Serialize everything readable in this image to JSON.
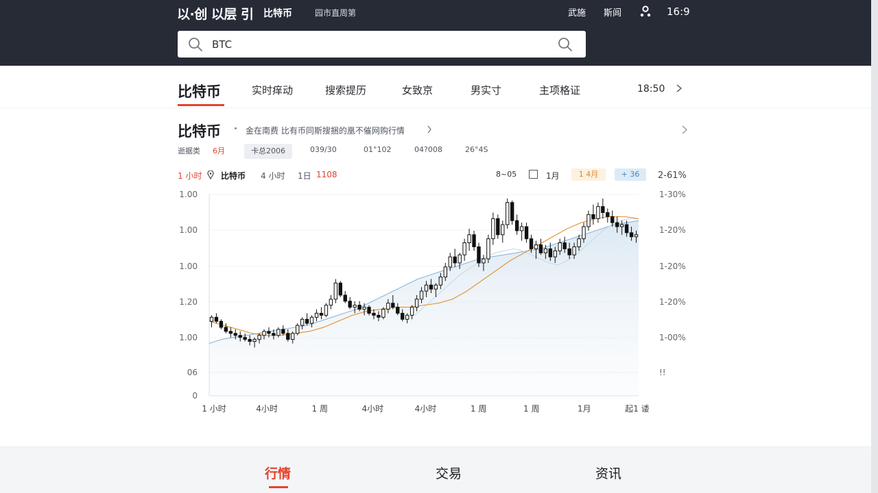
{
  "header": {
    "logo": "以·创 以层 引",
    "nav_primary": "比特币",
    "nav_secondary": "园市直周第",
    "right_links": [
      "武施",
      "斯闾"
    ],
    "clock": "16:9"
  },
  "search": {
    "value": "BTC",
    "placeholder": "BTC"
  },
  "tabs": {
    "active": "比特币",
    "items": [
      "实时痒动",
      "搜索提历",
      "女致京",
      "男实寸",
      "主项格证"
    ],
    "time": "18:50"
  },
  "section": {
    "title": "比特币",
    "desc": "金在南费 比有币同斯搜捆的凰不催网购行情",
    "filter_label": "逝据类",
    "filter_value": "6月",
    "chip": "卡总2006",
    "periods": [
      "039/30",
      "01°102",
      "04?008",
      "26°4S"
    ]
  },
  "chart_header": {
    "interval_active": "1 小时",
    "asset": "比特币",
    "interval_4h": "4 小时",
    "interval_1d": "1日",
    "interval_1d_value": "1108",
    "range_label": "8~05",
    "month_1": "1月",
    "pill_4m": "1 4月",
    "pill_36": "+ 36",
    "right_pct": "2-61%"
  },
  "chart_data": {
    "type": "line",
    "title": "",
    "xlabel": "",
    "ylabel": "",
    "x_ticks": [
      "1 小时",
      "4小时",
      "1 周",
      "4小时",
      "4小时",
      "1 周",
      "1 周",
      "1月",
      "起1 诿"
    ],
    "y_ticks_left": [
      "1.00",
      "1.00",
      "1.00",
      "1.20",
      "1.00",
      "06",
      "0"
    ],
    "y_ticks_right": [
      "1-30%",
      "1-20%",
      "1-20%",
      "1-20%",
      "1-00%",
      "!!"
    ],
    "ylim": [
      0,
      100
    ],
    "grid": true,
    "candles": [
      [
        37,
        40,
        34,
        39
      ],
      [
        39,
        41,
        36,
        37
      ],
      [
        37,
        38,
        33,
        34
      ],
      [
        34,
        36,
        31,
        32
      ],
      [
        32,
        34,
        29,
        31
      ],
      [
        31,
        33,
        28,
        30
      ],
      [
        30,
        32,
        27,
        29
      ],
      [
        29,
        31,
        27,
        28
      ],
      [
        28,
        30,
        25,
        27
      ],
      [
        27,
        29,
        24,
        28
      ],
      [
        28,
        31,
        26,
        30
      ],
      [
        30,
        33,
        28,
        32
      ],
      [
        32,
        34,
        29,
        31
      ],
      [
        31,
        33,
        28,
        30
      ],
      [
        30,
        34,
        29,
        33
      ],
      [
        33,
        35,
        30,
        31
      ],
      [
        31,
        33,
        27,
        28
      ],
      [
        28,
        32,
        26,
        31
      ],
      [
        31,
        36,
        30,
        35
      ],
      [
        35,
        39,
        33,
        38
      ],
      [
        38,
        41,
        35,
        36
      ],
      [
        36,
        40,
        34,
        39
      ],
      [
        39,
        43,
        37,
        41
      ],
      [
        41,
        44,
        38,
        40
      ],
      [
        40,
        46,
        39,
        45
      ],
      [
        45,
        50,
        43,
        48
      ],
      [
        48,
        58,
        46,
        56
      ],
      [
        56,
        57,
        49,
        50
      ],
      [
        50,
        52,
        46,
        47
      ],
      [
        47,
        49,
        43,
        44
      ],
      [
        44,
        47,
        41,
        45
      ],
      [
        45,
        47,
        42,
        43
      ],
      [
        43,
        46,
        40,
        44
      ],
      [
        44,
        45,
        40,
        41
      ],
      [
        41,
        43,
        38,
        40
      ],
      [
        40,
        42,
        37,
        39
      ],
      [
        39,
        44,
        38,
        43
      ],
      [
        43,
        48,
        41,
        46
      ],
      [
        46,
        50,
        43,
        44
      ],
      [
        44,
        46,
        40,
        41
      ],
      [
        41,
        43,
        37,
        38
      ],
      [
        38,
        41,
        36,
        40
      ],
      [
        40,
        45,
        38,
        44
      ],
      [
        44,
        50,
        42,
        48
      ],
      [
        48,
        54,
        46,
        52
      ],
      [
        52,
        57,
        49,
        55
      ],
      [
        55,
        58,
        51,
        53
      ],
      [
        53,
        56,
        49,
        55
      ],
      [
        55,
        61,
        53,
        59
      ],
      [
        59,
        66,
        57,
        64
      ],
      [
        64,
        71,
        62,
        69
      ],
      [
        69,
        73,
        64,
        66
      ],
      [
        66,
        71,
        63,
        70
      ],
      [
        70,
        78,
        67,
        76
      ],
      [
        76,
        83,
        72,
        80
      ],
      [
        80,
        82,
        72,
        74
      ],
      [
        74,
        76,
        64,
        66
      ],
      [
        66,
        70,
        62,
        68
      ],
      [
        68,
        80,
        66,
        78
      ],
      [
        78,
        91,
        75,
        88
      ],
      [
        88,
        90,
        78,
        80
      ],
      [
        80,
        87,
        76,
        85
      ],
      [
        85,
        98,
        83,
        96
      ],
      [
        96,
        97,
        85,
        87
      ],
      [
        87,
        90,
        80,
        82
      ],
      [
        82,
        86,
        77,
        84
      ],
      [
        84,
        86,
        76,
        78
      ],
      [
        78,
        80,
        71,
        73
      ],
      [
        73,
        77,
        68,
        75
      ],
      [
        75,
        78,
        70,
        71
      ],
      [
        71,
        75,
        68,
        73
      ],
      [
        73,
        76,
        67,
        69
      ],
      [
        69,
        74,
        66,
        72
      ],
      [
        72,
        78,
        70,
        76
      ],
      [
        76,
        79,
        71,
        73
      ],
      [
        73,
        76,
        68,
        70
      ],
      [
        70,
        76,
        68,
        74
      ],
      [
        74,
        80,
        72,
        78
      ],
      [
        78,
        86,
        76,
        84
      ],
      [
        84,
        92,
        82,
        90
      ],
      [
        90,
        95,
        85,
        88
      ],
      [
        88,
        96,
        86,
        94
      ],
      [
        94,
        98,
        88,
        91
      ],
      [
        91,
        93,
        86,
        89
      ],
      [
        89,
        92,
        84,
        86
      ],
      [
        86,
        89,
        81,
        84
      ],
      [
        84,
        87,
        80,
        85
      ],
      [
        85,
        87,
        79,
        81
      ],
      [
        81,
        84,
        77,
        79
      ],
      [
        79,
        82,
        76,
        80
      ]
    ],
    "series": [
      {
        "values": [
          26,
          28,
          29,
          30,
          31,
          32,
          33,
          34,
          35,
          37,
          39,
          41,
          43,
          46,
          49,
          52,
          55,
          58,
          60,
          62,
          64,
          66,
          68,
          69,
          70,
          71,
          72,
          73,
          75,
          77,
          79,
          81,
          83,
          85,
          86,
          87
        ]
      },
      {
        "values": [
          40,
          44,
          48,
          52,
          56,
          60,
          63,
          66,
          69,
          71,
          72,
          73,
          72,
          70,
          68,
          66,
          65,
          67,
          70,
          74,
          78,
          82,
          85,
          87,
          88,
          88
        ]
      },
      {
        "values": [
          37,
          35,
          33,
          31,
          30,
          30,
          31,
          32,
          34,
          37,
          40,
          42,
          43,
          44,
          44,
          45,
          46,
          48,
          52,
          57,
          62,
          67,
          71,
          75,
          79,
          83,
          86,
          88,
          89,
          89,
          88
        ]
      }
    ]
  },
  "bottom_nav": {
    "items": [
      "行情",
      "交易",
      "资讯"
    ]
  },
  "colors": {
    "accent": "#e2442f",
    "header_bg": "#262b36",
    "line_orange": "#e8953a",
    "line_blue": "#8fb4d9"
  }
}
